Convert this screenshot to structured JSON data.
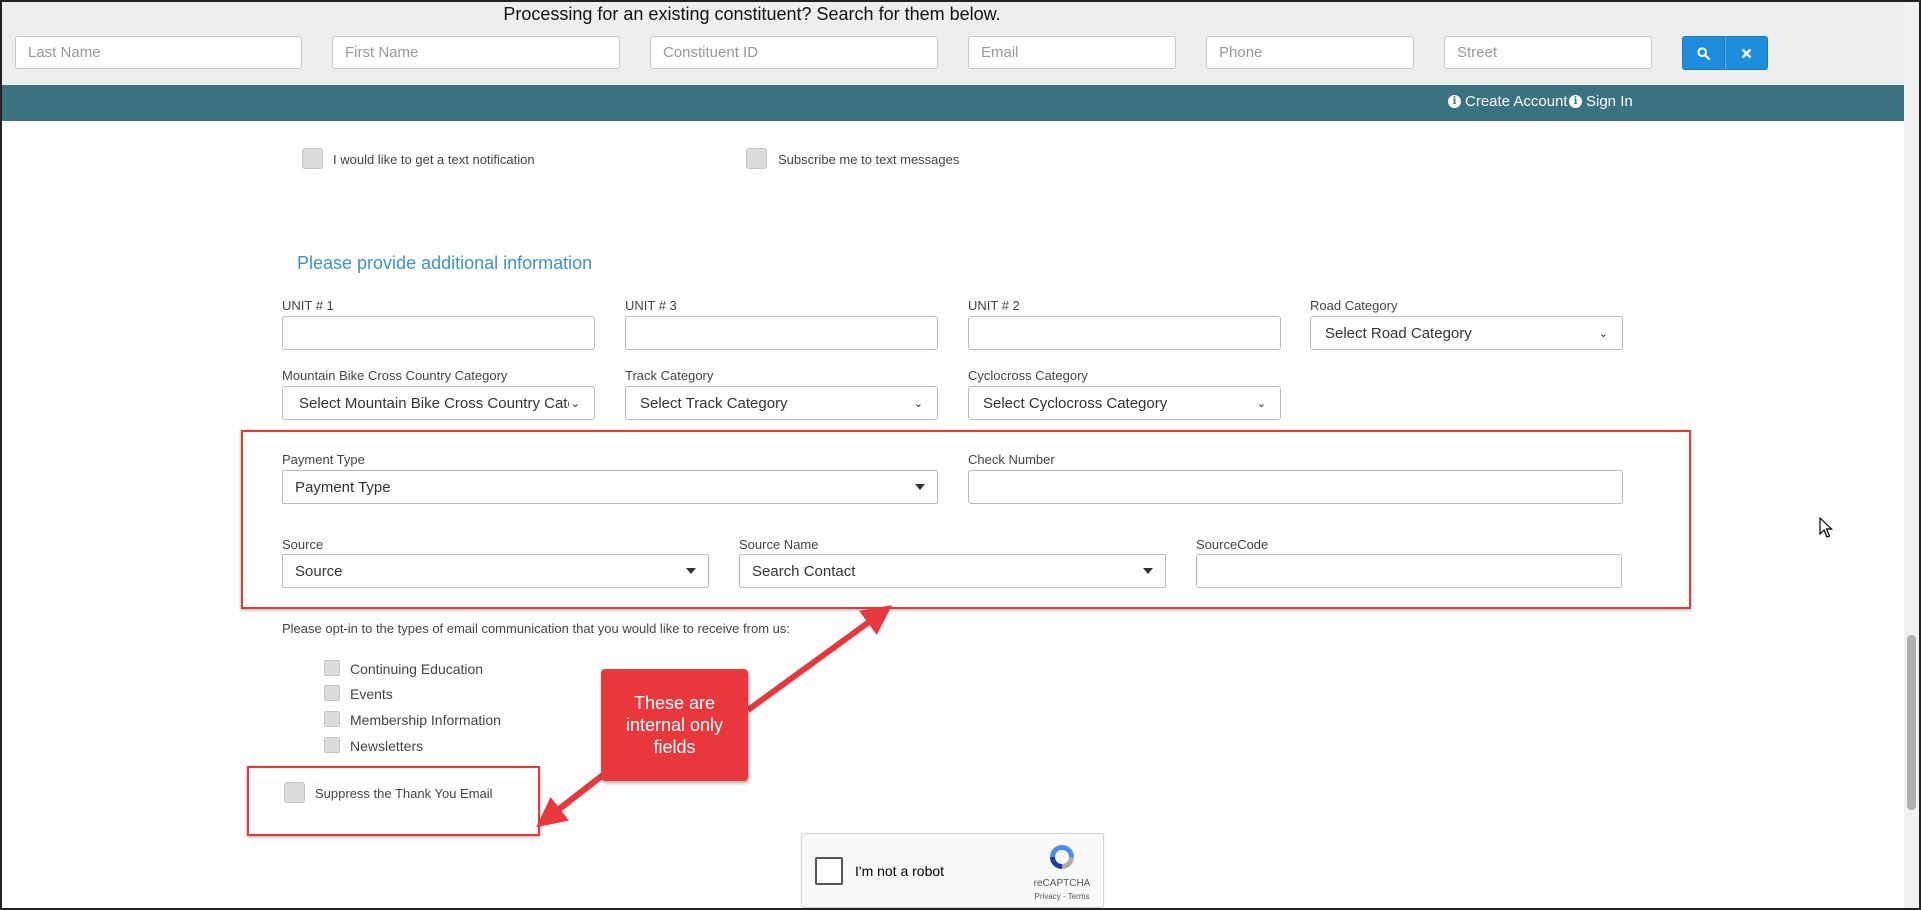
{
  "search_bar": {
    "heading": "Processing for an existing constituent? Search for them below.",
    "fields": {
      "last_name": "Last Name",
      "first_name": "First Name",
      "constituent_id": "Constituent ID",
      "email": "Email",
      "phone": "Phone",
      "street": "Street"
    }
  },
  "nav": {
    "create_account": "Create Account",
    "sign_in": "Sign In"
  },
  "notifications": {
    "text_notification": "I would like to get a text notification",
    "subscribe_text": "Subscribe me to text messages"
  },
  "additional": {
    "title": "Please provide additional information",
    "unit1_label": "UNIT # 1",
    "unit3_label": "UNIT # 3",
    "unit2_label": "UNIT # 2",
    "road_label": "Road Category",
    "road_value": "Select Road Category",
    "mtb_label": "Mountain Bike Cross Country Category",
    "mtb_value": "Select Mountain Bike Cross Country Categ",
    "track_label": "Track Category",
    "track_value": "Select Track Category",
    "cyclo_label": "Cyclocross Category",
    "cyclo_value": "Select Cyclocross Category"
  },
  "internal": {
    "payment_type_label": "Payment Type",
    "payment_type_value": "Payment Type",
    "check_number_label": "Check Number",
    "source_label": "Source",
    "source_value": "Source",
    "source_name_label": "Source Name",
    "source_name_value": "Search Contact",
    "source_code_label": "SourceCode"
  },
  "optin": {
    "prompt": "Please opt-in to the types of email communication that you would like to receive from us:",
    "items": [
      "Continuing Education",
      "Events",
      "Membership Information",
      "Newsletters"
    ]
  },
  "suppress_label": "Suppress the Thank You Email",
  "callout": "These are internal only fields",
  "recaptcha": {
    "label": "I'm not a robot",
    "brand": "reCAPTCHA",
    "terms": "Privacy - Terms"
  },
  "colors": {
    "nav_bg": "#3a7280",
    "accent_blue": "#1e8ddb",
    "section_title": "#3a93d0",
    "annotation_red": "#e8383d"
  },
  "icons": [
    "search-icon",
    "close-icon",
    "info-icon",
    "chevron-down-icon",
    "caret-down-icon",
    "recaptcha-logo-icon",
    "mouse-cursor-icon"
  ]
}
